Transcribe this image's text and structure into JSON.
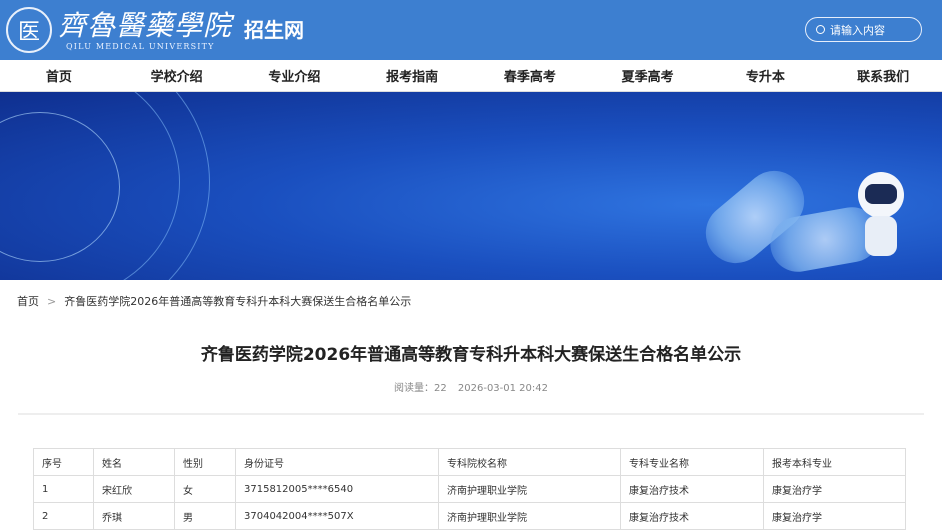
{
  "header": {
    "seal_char": "医",
    "logo_cn": "齊魯醫藥學院",
    "logo_en": "QILU MEDICAL UNIVERSITY",
    "site": "招生网",
    "search_placeholder": "请输入内容"
  },
  "nav": [
    "首页",
    "学校介绍",
    "专业介绍",
    "报考指南",
    "春季高考",
    "夏季高考",
    "专升本",
    "联系我们"
  ],
  "breadcrumb": {
    "home": "首页",
    "sep": ">",
    "current": "齐鲁医药学院2026年普通高等教育专科升本科大赛保送生合格名单公示"
  },
  "article": {
    "title": "齐鲁医药学院2026年普通高等教育专科升本科大赛保送生合格名单公示",
    "views": "阅读量：22",
    "date": "2026-03-01 20:42"
  },
  "table": {
    "headers": [
      "序号",
      "姓名",
      "性别",
      "身份证号",
      "专科院校名称",
      "专科专业名称",
      "报考本科专业"
    ],
    "rows": [
      [
        "1",
        "宋红欣",
        "女",
        "3715812005****6540",
        "济南护理职业学院",
        "康复治疗技术",
        "康复治疗学"
      ],
      [
        "2",
        "乔琪",
        "男",
        "3704042004****507X",
        "济南护理职业学院",
        "康复治疗技术",
        "康复治疗学"
      ]
    ]
  }
}
